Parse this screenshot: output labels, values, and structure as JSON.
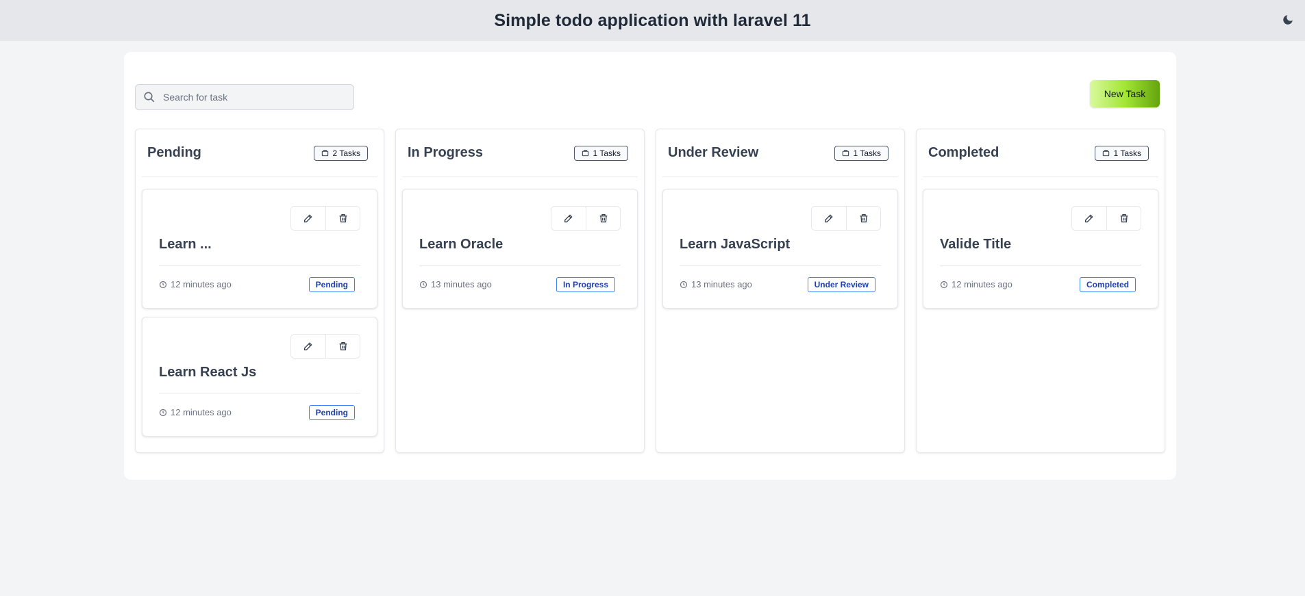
{
  "header": {
    "title": "Simple todo application with laravel 11",
    "theme_icon": "moon-icon"
  },
  "search": {
    "placeholder": "Search for task",
    "value": ""
  },
  "toolbar": {
    "new_task_label": "New Task",
    "accent": "#84cc16"
  },
  "columns": [
    {
      "title": "Pending",
      "count_label": "2 Tasks",
      "cards": [
        {
          "title": "Learn ...",
          "time": "12 minutes ago",
          "status": "Pending"
        },
        {
          "title": "Learn React Js",
          "time": "12 minutes ago",
          "status": "Pending"
        }
      ]
    },
    {
      "title": "In Progress",
      "count_label": "1 Tasks",
      "cards": [
        {
          "title": "Learn Oracle",
          "time": "13 minutes ago",
          "status": "In Progress"
        }
      ]
    },
    {
      "title": "Under Review",
      "count_label": "1 Tasks",
      "cards": [
        {
          "title": "Learn JavaScript",
          "time": "13 minutes ago",
          "status": "Under Review"
        }
      ]
    },
    {
      "title": "Completed",
      "count_label": "1 Tasks",
      "cards": [
        {
          "title": "Valide Title",
          "time": "12 minutes ago",
          "status": "Completed"
        }
      ]
    }
  ],
  "colors": {
    "status_border": "#3b82f6",
    "status_text": "#1e40af"
  }
}
